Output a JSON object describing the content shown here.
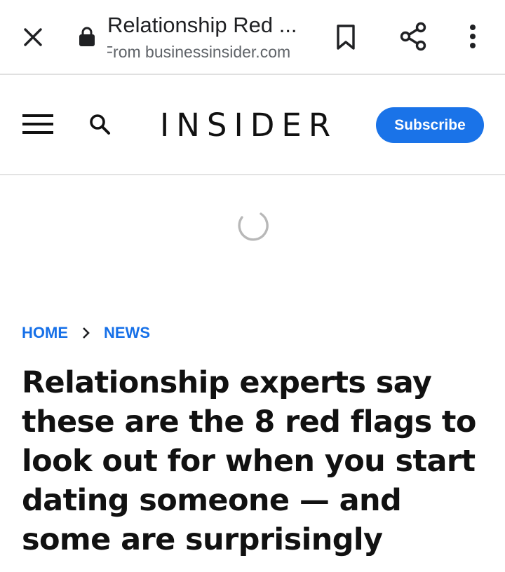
{
  "browser_toolbar": {
    "page_title": "Relationship Red ...",
    "source": "From businessinsider.com",
    "close_icon": "close-icon",
    "lock_icon": "lock-icon",
    "bookmark_icon": "bookmark-icon",
    "share_icon": "share-icon",
    "menu_icon": "more-vert-icon"
  },
  "site_header": {
    "logo": "INSIDER",
    "menu_icon": "hamburger-menu-icon",
    "search_icon": "search-icon",
    "subscribe_label": "Subscribe"
  },
  "colors": {
    "accent": "#1a73e8",
    "breadcrumb": "#1670e8",
    "headline": "#111111"
  },
  "breadcrumb": {
    "items": [
      "HOME",
      "NEWS"
    ],
    "separator_icon": "chevron-right-icon"
  },
  "article": {
    "headline": "Relationship experts say these are the 8 red flags to look out for when you start dating someone — and some are surprisingly common"
  }
}
